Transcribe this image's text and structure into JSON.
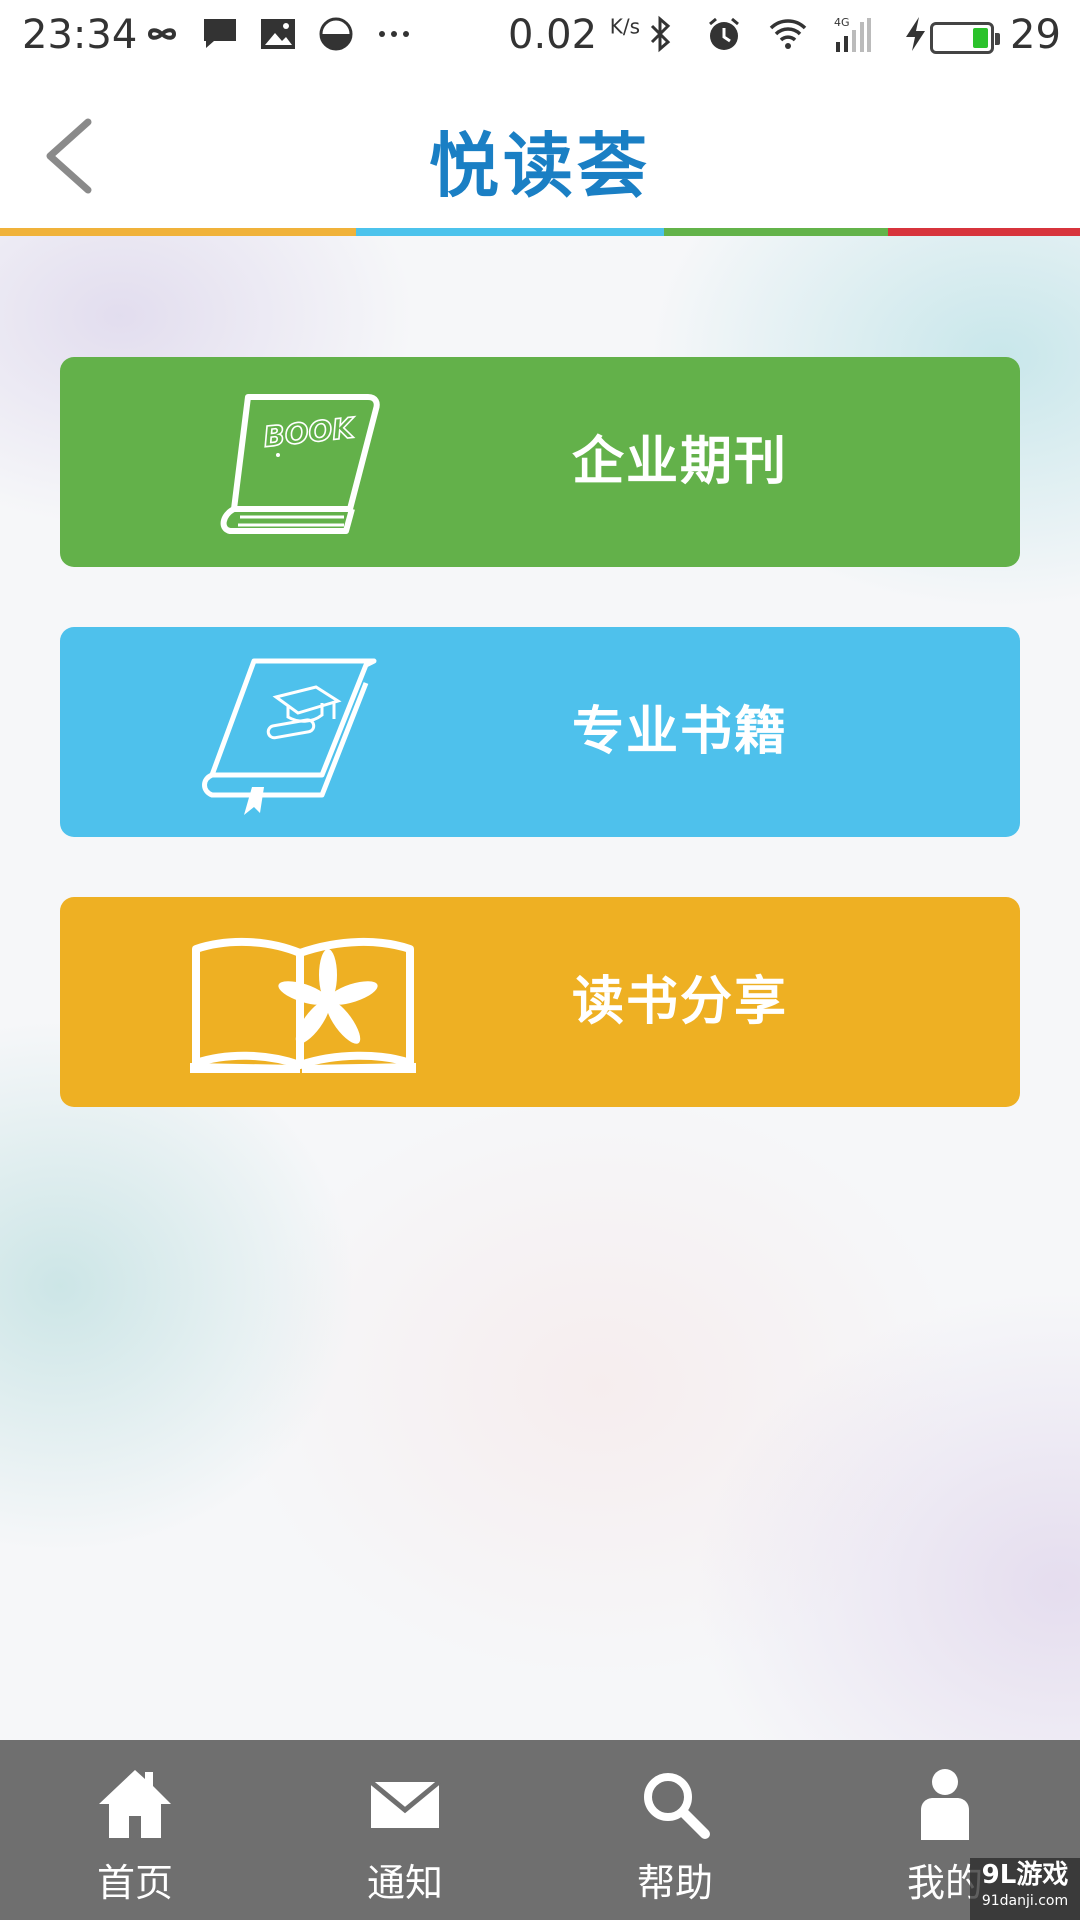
{
  "status_bar": {
    "time": "23:34",
    "net_speed": "0.02",
    "net_unit": "K/s",
    "network_type": "4G",
    "battery_percent": "29",
    "battery_level": 0.29,
    "left_icons": [
      "infinity-icon",
      "message-icon",
      "image-icon",
      "half-circle-icon",
      "more-dots-icon"
    ],
    "right_icons": [
      "bluetooth-icon",
      "alarm-icon",
      "wifi-icon",
      "signal-icon",
      "charging-icon",
      "battery-icon"
    ]
  },
  "header": {
    "title": "悦读荟",
    "back_icon": "chevron-left-icon",
    "stripe_colors": [
      "#f0b23a",
      "#4cc3ec",
      "#63b34a",
      "#d7343c"
    ],
    "title_color": "#1a7fc4"
  },
  "menu": [
    {
      "label": "企业期刊",
      "icon": "book-icon",
      "icon_text": "BOOK",
      "color": "#63b14a"
    },
    {
      "label": "专业书籍",
      "icon": "graduation-book-icon",
      "color": "#4ec1ec"
    },
    {
      "label": "读书分享",
      "icon": "open-book-leaf-icon",
      "color": "#eeb023"
    }
  ],
  "bottom_nav": [
    {
      "label": "首页",
      "icon": "home-icon"
    },
    {
      "label": "通知",
      "icon": "mail-icon"
    },
    {
      "label": "帮助",
      "icon": "search-icon"
    },
    {
      "label": "我的",
      "icon": "user-icon"
    }
  ],
  "watermark": {
    "line1": "9L游戏",
    "line2": "91danji.com"
  }
}
